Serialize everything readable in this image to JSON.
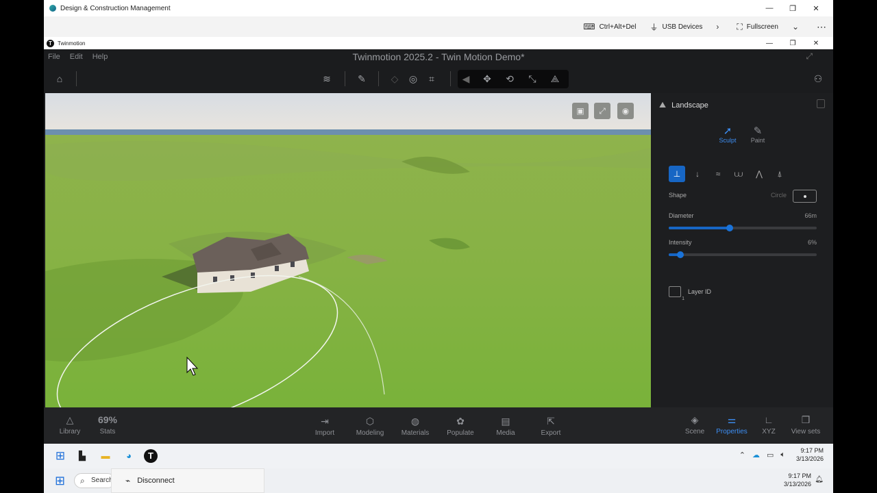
{
  "remote_window": {
    "title": "Design & Construction Management",
    "controls": [
      "—",
      "❐",
      "✕"
    ]
  },
  "remote_toolbar": {
    "items": [
      {
        "icon": "keyboard-icon",
        "label": "Ctrl+Alt+Del"
      },
      {
        "icon": "usb-icon",
        "label": "USB Devices"
      },
      {
        "icon": "chevron-right-icon",
        "label": ""
      },
      {
        "icon": "fullscreen-icon",
        "label": "Fullscreen"
      },
      {
        "icon": "chevron-down-icon",
        "label": ""
      },
      {
        "icon": "more-icon",
        "label": "⋯"
      }
    ]
  },
  "tm_window": {
    "title": "Twinmotion",
    "controls": [
      "—",
      "❐",
      "✕"
    ]
  },
  "menu": {
    "items": [
      "File",
      "Edit",
      "Help"
    ],
    "title": "Twinmotion 2025.2 - Twin Motion Demo*"
  },
  "panel": {
    "title": "Landscape",
    "modes": [
      {
        "label": "Sculpt",
        "icon": "sculpt-arrow-icon",
        "active": true
      },
      {
        "label": "Paint",
        "icon": "paint-brush-icon",
        "active": false
      }
    ],
    "tools": [
      "raise-icon",
      "lower-icon",
      "smooth-icon",
      "flatten-icon",
      "noise-icon",
      "pinch-icon"
    ],
    "shape_label": "Shape",
    "shape_value": "Circle",
    "diameter_label": "Diameter",
    "diameter_value": "66m",
    "diameter_level": 0.41,
    "intensity_label": "Intensity",
    "intensity_value": "6%",
    "intensity_level": 0.08,
    "layer_label": "Layer ID"
  },
  "bottom": {
    "left": [
      {
        "label": "Library",
        "icon": "library-shapes-icon"
      },
      {
        "label": "Stats",
        "icon": "69%"
      }
    ],
    "center": [
      {
        "label": "Import",
        "icon": "import-icon"
      },
      {
        "label": "Modeling",
        "icon": "cube-icon"
      },
      {
        "label": "Materials",
        "icon": "sphere-icon"
      },
      {
        "label": "Populate",
        "icon": "populate-icon"
      },
      {
        "label": "Media",
        "icon": "media-icon"
      },
      {
        "label": "Export",
        "icon": "export-icon"
      }
    ],
    "right": [
      {
        "label": "Scene",
        "icon": "layers-icon"
      },
      {
        "label": "Properties",
        "icon": "sliders-icon",
        "active": true
      },
      {
        "label": "XYZ",
        "icon": "axis-icon"
      },
      {
        "label": "View sets",
        "icon": "viewsets-icon"
      }
    ]
  },
  "remote_taskbar": {
    "time": "9:17 PM",
    "date": "3/13/2026"
  },
  "local_taskbar": {
    "search": "Search",
    "disconnect": "Disconnect",
    "time": "9:17 PM",
    "date": "3/13/2026"
  },
  "colors": {
    "accent": "#1766c4",
    "active_text": "#3d8ff5",
    "grass": "#7faa3e",
    "sky": "#dfe4ea"
  }
}
